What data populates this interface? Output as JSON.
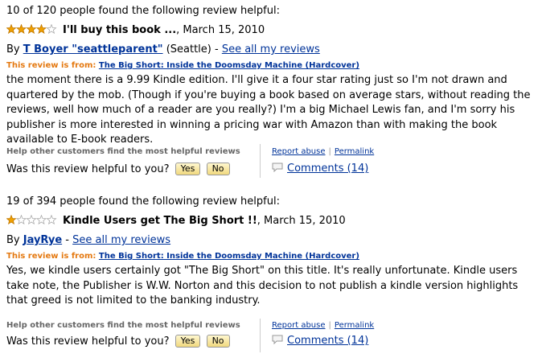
{
  "reviews": [
    {
      "helpful_count": "10 of 120 people found the following review helpful:",
      "rating": 4,
      "title": "I'll buy this book ...",
      "date": ", March 15, 2010",
      "by": "By ",
      "author": "T Boyer \"seattleparent\"",
      "location": " (Seattle) - ",
      "see_all": "See all my reviews",
      "from_label": "This review is from: ",
      "from_product": "The Big Short: Inside the Doomsday Machine (Hardcover)",
      "body": "the moment there is a 9.99 Kindle edition. I'll give it a four star rating just so I'm not drawn and quartered by the mob. (Though if you're buying a book based on average stars, without reading the reviews, well how much of a reader are you really?) I'm a big Michael Lewis fan, and I'm sorry his publisher is more interested in winning a pricing war with Amazon than with making the book available to E-book readers.",
      "help_other": "Help other customers find the most helpful reviews",
      "was_helpful": "Was this review helpful to you?",
      "yes": "Yes",
      "no": "No",
      "report_abuse": "Report abuse",
      "separator": "|",
      "permalink": "Permalink",
      "comments": "Comments (14)"
    },
    {
      "helpful_count": "19 of 394 people found the following review helpful:",
      "rating": 1,
      "title": "Kindle Users get The Big Short !!",
      "date": ", March 15, 2010",
      "by": "By ",
      "author": "JayRye",
      "location": " - ",
      "see_all": "See all my reviews",
      "from_label": "This review is from: ",
      "from_product": "The Big Short: Inside the Doomsday Machine (Hardcover)",
      "body": "Yes, we kindle users certainly got \"The Big Short\" on this title. It's really unfortunate. Kindle users take note, the Publisher is W.W. Norton and this decision to not publish a kindle version highlights that greed is not limited to the banking industry.",
      "help_other": "Help other customers find the most helpful reviews",
      "was_helpful": "Was this review helpful to you?",
      "yes": "Yes",
      "no": "No",
      "report_abuse": "Report abuse",
      "separator": "|",
      "permalink": "Permalink",
      "comments": "Comments (14)"
    }
  ],
  "colors": {
    "link": "#003399",
    "from_label": "#e47911",
    "star_fill": "#f0a000",
    "button": "#f0d87e"
  }
}
